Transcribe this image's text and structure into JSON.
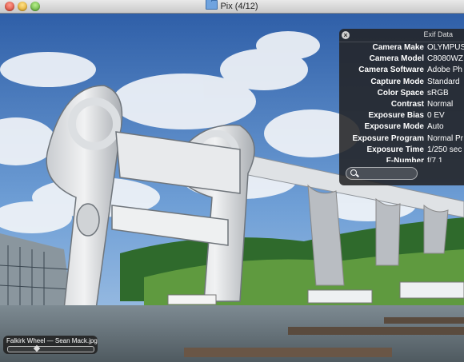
{
  "window": {
    "title": "Pix (4/12)"
  },
  "exif": {
    "title": "Exif Data",
    "rows": [
      {
        "key": "Camera Make",
        "value": "OLYMPUS"
      },
      {
        "key": "Camera Model",
        "value": "C8080WZ"
      },
      {
        "key": "Camera Software",
        "value": "Adobe Ph"
      },
      {
        "key": "Capture Mode",
        "value": "Standard"
      },
      {
        "key": "Color Space",
        "value": "sRGB"
      },
      {
        "key": "Contrast",
        "value": "Normal"
      },
      {
        "key": "Exposure Bias",
        "value": "0 EV"
      },
      {
        "key": "Exposure Mode",
        "value": "Auto"
      },
      {
        "key": "Exposure Program",
        "value": "Normal Pr"
      },
      {
        "key": "Exposure Time",
        "value": "1/250 sec"
      },
      {
        "key": "F-Number",
        "value": "f/7.1"
      }
    ],
    "search_placeholder": ""
  },
  "caption": {
    "text": "Falkirk Wheel — Sean Mack.jpg",
    "position_fraction": 0.33
  },
  "icons": [
    "close-window-icon",
    "minimize-window-icon",
    "zoom-window-icon",
    "folder-icon",
    "close-icon",
    "search-icon"
  ]
}
